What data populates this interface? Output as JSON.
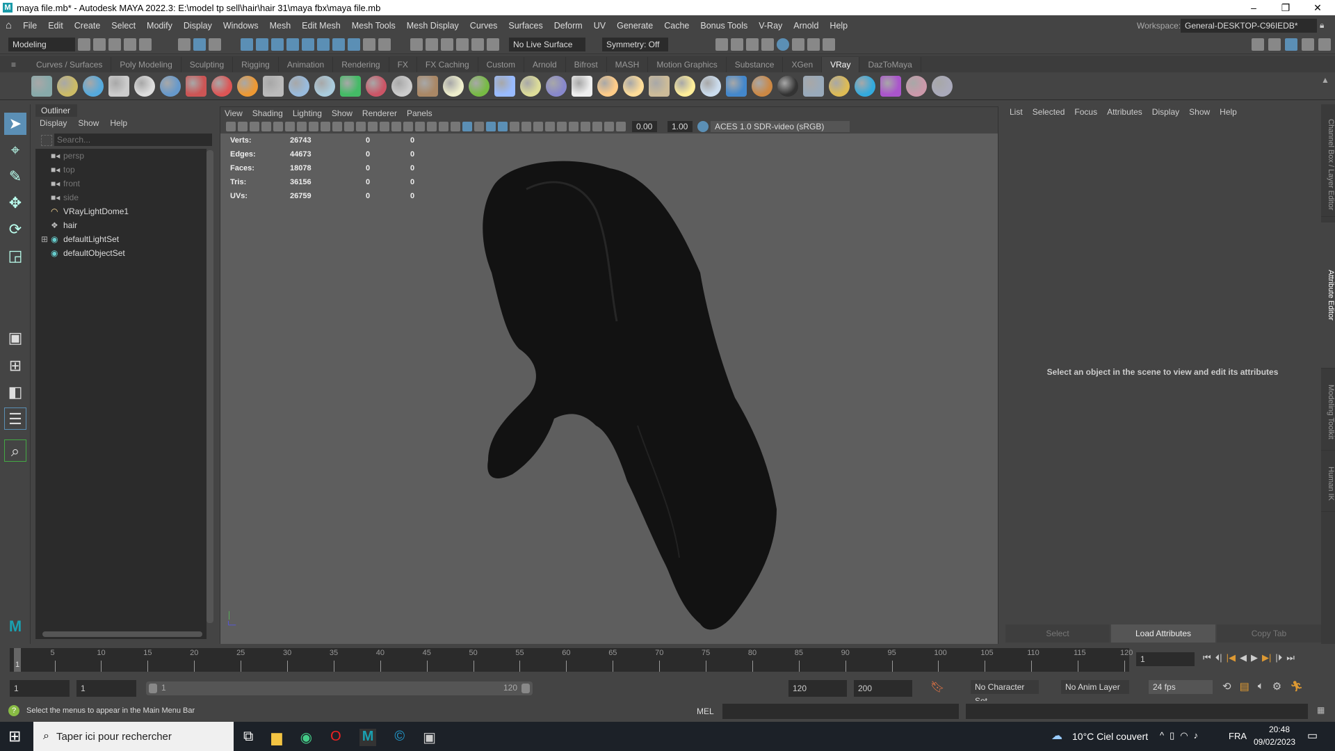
{
  "title": "maya file.mb* - Autodesk MAYA 2022.3: E:\\model tp sell\\hair\\hair 31\\maya fbx\\maya file.mb",
  "window_controls": {
    "minimize": "–",
    "maximize": "❐",
    "close": "✕"
  },
  "menu": [
    "File",
    "Edit",
    "Create",
    "Select",
    "Modify",
    "Display",
    "Windows",
    "Mesh",
    "Edit Mesh",
    "Mesh Tools",
    "Mesh Display",
    "Curves",
    "Surfaces",
    "Deform",
    "UV",
    "Generate",
    "Cache",
    "Bonus Tools",
    "V-Ray",
    "Arnold",
    "Help"
  ],
  "workspace": {
    "label": "Workspace:",
    "value": "General-DESKTOP-C96IEDB*"
  },
  "status_line": {
    "mode": "Modeling",
    "live_surface": "No Live Surface",
    "symmetry": "Symmetry: Off"
  },
  "shelf_tabs": [
    "Curves / Surfaces",
    "Poly Modeling",
    "Sculpting",
    "Rigging",
    "Animation",
    "Rendering",
    "FX",
    "FX Caching",
    "Custom",
    "Arnold",
    "Bifrost",
    "MASH",
    "Motion Graphics",
    "Substance",
    "XGen",
    "VRay",
    "DazToMaya"
  ],
  "active_shelf": "VRay",
  "shelf_icon_colors": [
    "#8aa",
    "#cb6",
    "#5ad",
    "#ccc",
    "#ddd",
    "#69c",
    "#c55",
    "#d55",
    "#e93",
    "#bbb",
    "#9bd",
    "#acd",
    "#4b6",
    "#c56",
    "#ccc",
    "#a86",
    "#eec",
    "#7b4",
    "#9bf",
    "#dd9",
    "#88c",
    "#eee",
    "#fc8",
    "#fd9",
    "#cb9",
    "#fe9",
    "#cde",
    "#48c",
    "#c84",
    "#333",
    "#9ab",
    "#db5",
    "#3ad",
    "#a5c",
    "#c9a",
    "#aab"
  ],
  "outliner": {
    "title": "Outliner",
    "menu": [
      "Display",
      "Show",
      "Help"
    ],
    "search_placeholder": "Search...",
    "items": [
      {
        "label": "persp",
        "icon": "camera-icon",
        "dim": true
      },
      {
        "label": "top",
        "icon": "camera-icon",
        "dim": true
      },
      {
        "label": "front",
        "icon": "camera-icon",
        "dim": true
      },
      {
        "label": "side",
        "icon": "camera-icon",
        "dim": true
      },
      {
        "label": "VRayLightDome1",
        "icon": "dome-light-icon",
        "dim": false
      },
      {
        "label": "hair",
        "icon": "mesh-icon",
        "dim": false
      },
      {
        "label": "defaultLightSet",
        "icon": "set-icon",
        "dim": false,
        "expandable": true
      },
      {
        "label": "defaultObjectSet",
        "icon": "set-icon",
        "dim": false
      }
    ]
  },
  "viewport": {
    "menu": [
      "View",
      "Shading",
      "Lighting",
      "Show",
      "Renderer",
      "Panels"
    ],
    "exposure": "0.00",
    "gamma": "1.00",
    "color_space": "ACES 1.0 SDR-video (sRGB)",
    "hud": [
      {
        "label": "Verts:",
        "v": [
          "26743",
          "0",
          "0"
        ]
      },
      {
        "label": "Edges:",
        "v": [
          "44673",
          "0",
          "0"
        ]
      },
      {
        "label": "Faces:",
        "v": [
          "18078",
          "0",
          "0"
        ]
      },
      {
        "label": "Tris:",
        "v": [
          "36156",
          "0",
          "0"
        ]
      },
      {
        "label": "UVs:",
        "v": [
          "26759",
          "0",
          "0"
        ]
      }
    ]
  },
  "attribute_editor": {
    "menu": [
      "List",
      "Selected",
      "Focus",
      "Attributes",
      "Display",
      "Show",
      "Help"
    ],
    "message": "Select an object in the scene to view and edit its attributes",
    "buttons": [
      "Select",
      "Load Attributes",
      "Copy Tab"
    ]
  },
  "side_tabs": [
    "Channel Box / Layer Editor",
    "Attribute Editor",
    "Modeling Toolkit",
    "Human IK"
  ],
  "timeline": {
    "start": 1,
    "end": 120,
    "step": 5,
    "current_frame": "1"
  },
  "range": {
    "start_field": "1",
    "playback_start": "1",
    "slider_start": "1",
    "slider_end": "120",
    "playback_end": "120",
    "end_field": "200",
    "character_set": "No Character Set",
    "anim_layer": "No Anim Layer",
    "fps": "24 fps"
  },
  "help_line": "Select the menus to appear in the Main Menu Bar",
  "command_line": {
    "language": "MEL"
  },
  "taskbar": {
    "search": "Taper ici pour rechercher",
    "weather": "10°C  Ciel couvert",
    "lang": "FRA",
    "time": "20:48",
    "date": "09/02/2023"
  }
}
